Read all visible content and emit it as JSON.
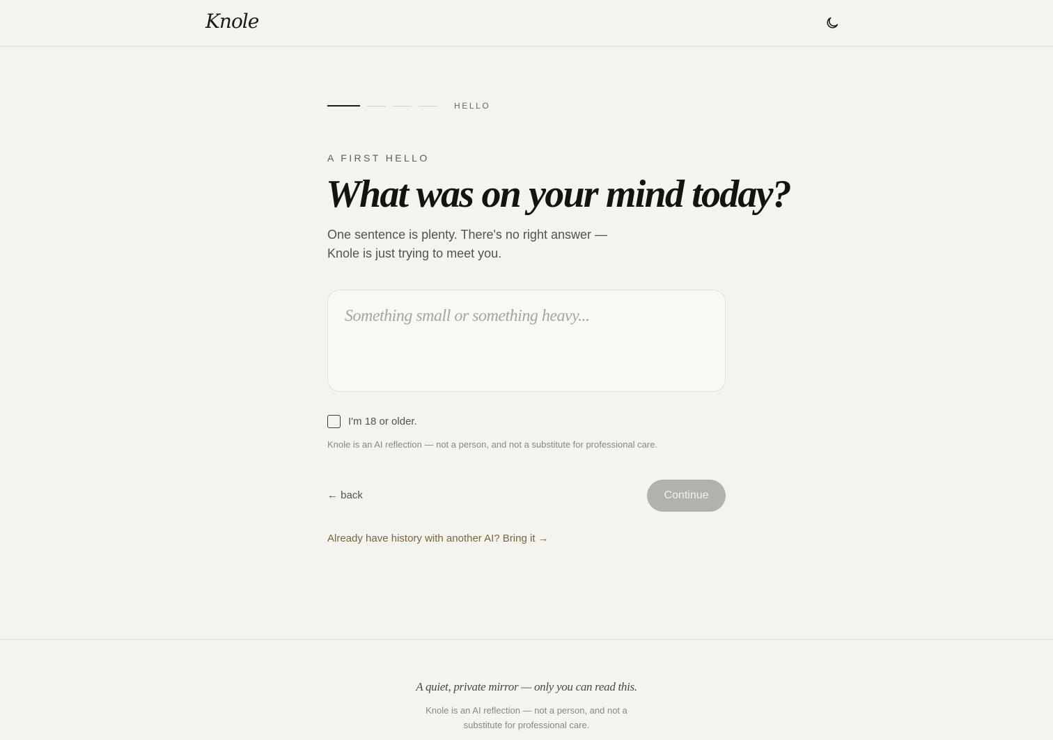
{
  "header": {
    "logo": "Knole",
    "theme_toggle_icon": "moon-icon"
  },
  "progress": {
    "total_steps": 4,
    "current_step": 1,
    "step_label": "HELLO"
  },
  "main": {
    "eyebrow": "A FIRST HELLO",
    "headline": "What was on your mind today?",
    "subtitle": "One sentence is plenty. There's no right answer — Knole is just trying to meet you.",
    "entry": {
      "value": "",
      "placeholder": "Something small or something heavy..."
    },
    "age_check": {
      "label": "I'm 18 or older.",
      "checked": false
    },
    "disclaimer": "Knole is an AI reflection — not a person, and not a substitute for professional care.",
    "back_label": "← back",
    "continue_label": "Continue",
    "import_link": "Already have history with another AI? Bring it →"
  },
  "footer": {
    "tagline": "A quiet, private mirror — only you can read this.",
    "note": "Knole is an AI reflection — not a person, and not a substitute for professional care."
  },
  "colors": {
    "background": "#f4f3ee",
    "text": "#1b1a17",
    "muted": "#8a877f",
    "accent_link": "#7a6440",
    "button_disabled": "#b3b1ac"
  }
}
